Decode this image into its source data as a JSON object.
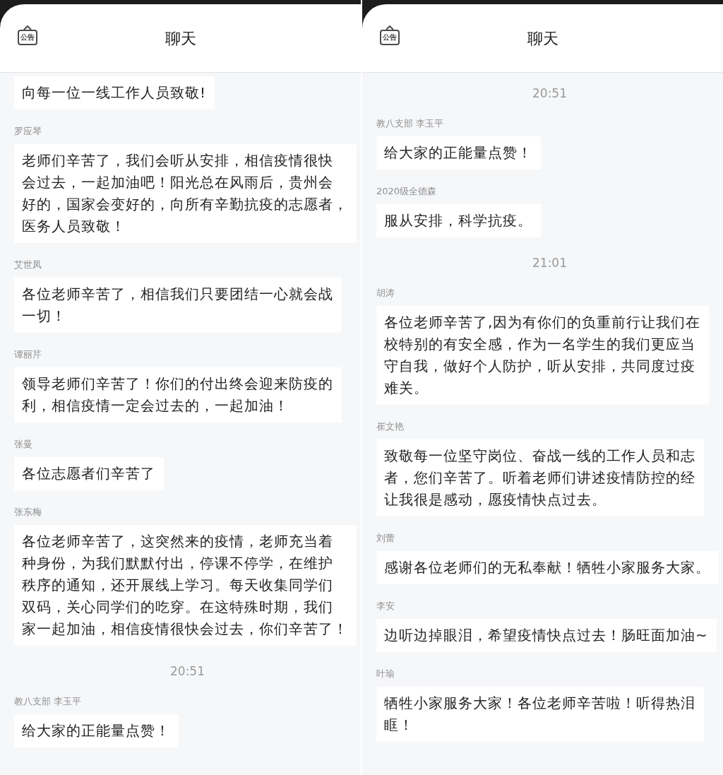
{
  "panels": [
    {
      "title": "聊天",
      "notice_label": "公告",
      "items": [
        {
          "kind": "message",
          "lines": [
            "向每一位一线工作人员致敬!"
          ]
        },
        {
          "kind": "message",
          "sender": "罗应琴",
          "lines": [
            "老师们辛苦了，我们会听从安排，相信疫情很快",
            "会过去，一起加油吧！阳光总在风雨后，贵州会",
            "好的，国家会变好的，向所有辛勤抗疫的志愿者，",
            "医务人员致敬！"
          ]
        },
        {
          "kind": "message",
          "sender": "艾世凤",
          "lines": [
            "各位老师辛苦了，相信我们只要团结一心就会战",
            "一切！"
          ]
        },
        {
          "kind": "message",
          "sender": "谭丽芹",
          "lines": [
            "领导老师们辛苦了！你们的付出终会迎来防疫的",
            "利，相信疫情一定会过去的，一起加油！"
          ]
        },
        {
          "kind": "message",
          "sender": "张曼",
          "lines": [
            "各位志愿者们辛苦了"
          ]
        },
        {
          "kind": "message",
          "sender": "张东梅",
          "lines": [
            "各位老师辛苦了，这突然来的疫情，老师充当着",
            "种身份，为我们默默付出，停课不停学，在维护",
            "秩序的通知，还开展线上学习。每天收集同学们",
            "双码，关心同学们的吃穿。在这特殊时期，我们",
            "家一起加油，相信疫情很快会过去，你们辛苦了！"
          ]
        },
        {
          "kind": "time",
          "text": "20:51"
        },
        {
          "kind": "message",
          "sender": "教八支部 李玉平",
          "lines": [
            "给大家的正能量点赞！"
          ]
        }
      ]
    },
    {
      "title": "聊天",
      "notice_label": "公告",
      "items": [
        {
          "kind": "time",
          "text": "20:51"
        },
        {
          "kind": "message",
          "sender": "教八支部 李玉平",
          "lines": [
            "给大家的正能量点赞！"
          ]
        },
        {
          "kind": "message",
          "sender": "2020级全德森",
          "lines": [
            "服从安排，科学抗疫。"
          ]
        },
        {
          "kind": "time",
          "text": "21:01"
        },
        {
          "kind": "message",
          "sender": "胡涛",
          "lines": [
            "各位老师辛苦了,因为有你们的负重前行让我们在",
            "校特别的有安全感，作为一名学生的我们更应当",
            "守自我，做好个人防护，听从安排，共同度过疫",
            "难关。"
          ]
        },
        {
          "kind": "message",
          "sender": "崔文艳",
          "lines": [
            "致敬每一位坚守岗位、奋战一线的工作人员和志",
            "者，您们辛苦了。听着老师们讲述疫情防控的经",
            "让我很是感动，愿疫情快点过去。"
          ]
        },
        {
          "kind": "message",
          "sender": "刘蕾",
          "lines": [
            "感谢各位老师们的无私奉献！牺牲小家服务大家。"
          ]
        },
        {
          "kind": "message",
          "sender": "李安",
          "lines": [
            "边听边掉眼泪，希望疫情快点过去！肠旺面加油~"
          ]
        },
        {
          "kind": "message",
          "sender": "叶瑜",
          "lines": [
            "牺牲小家服务大家！各位老师辛苦啦！听得热泪",
            "眶！"
          ]
        }
      ]
    }
  ]
}
